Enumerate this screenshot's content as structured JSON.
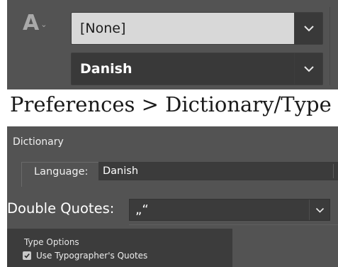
{
  "top_panel": {
    "char_icon": "A",
    "char_icon_caret": "⌄",
    "style_dropdown": {
      "value": "[None]"
    },
    "language_dropdown": {
      "value": "Danish"
    }
  },
  "heading": "Preferences > Dictionary/Type",
  "prefs": {
    "section_title": "Dictionary",
    "language_label": "Language:",
    "language_value": "Danish",
    "double_quotes_label": "Double Quotes:",
    "double_quotes_value": "„“",
    "type_options_title": "Type Options",
    "use_typographers_quotes_label": "Use Typographer's Quotes",
    "use_typographers_quotes_checked": true
  },
  "colors": {
    "panel_bg": "#535353",
    "field_bg": "#393939",
    "selected_field_bg": "#d8d8d8",
    "subpanel_bg": "#3c3c3c"
  }
}
